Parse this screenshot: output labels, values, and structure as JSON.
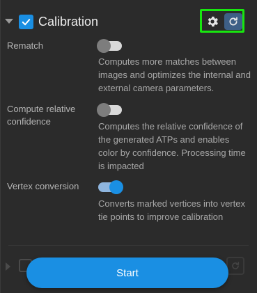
{
  "section": {
    "title": "Calibration",
    "enabled": true
  },
  "settings": [
    {
      "label": "Rematch",
      "on": false,
      "description": "Computes more matches between images and optimizes the internal and external camera parameters."
    },
    {
      "label": "Compute relative confidence",
      "on": false,
      "description": "Computes the relative confidence of the generated ATPs and enables color by confidence. Processing time is impacted"
    },
    {
      "label": "Vertex conversion",
      "on": true,
      "description": "Converts marked vertices into vertex tie points to improve calibration"
    }
  ],
  "actions": {
    "start_label": "Start"
  },
  "colors": {
    "accent": "#1a8fe3",
    "highlight_border": "#18e70f",
    "reset_bg": "#3e5f86",
    "panel_bg": "#2b2b2b"
  },
  "icons": {
    "collapse": "caret-down-icon",
    "checkbox": "checkmark-icon",
    "settings": "gear-icon",
    "reset": "refresh-icon"
  }
}
